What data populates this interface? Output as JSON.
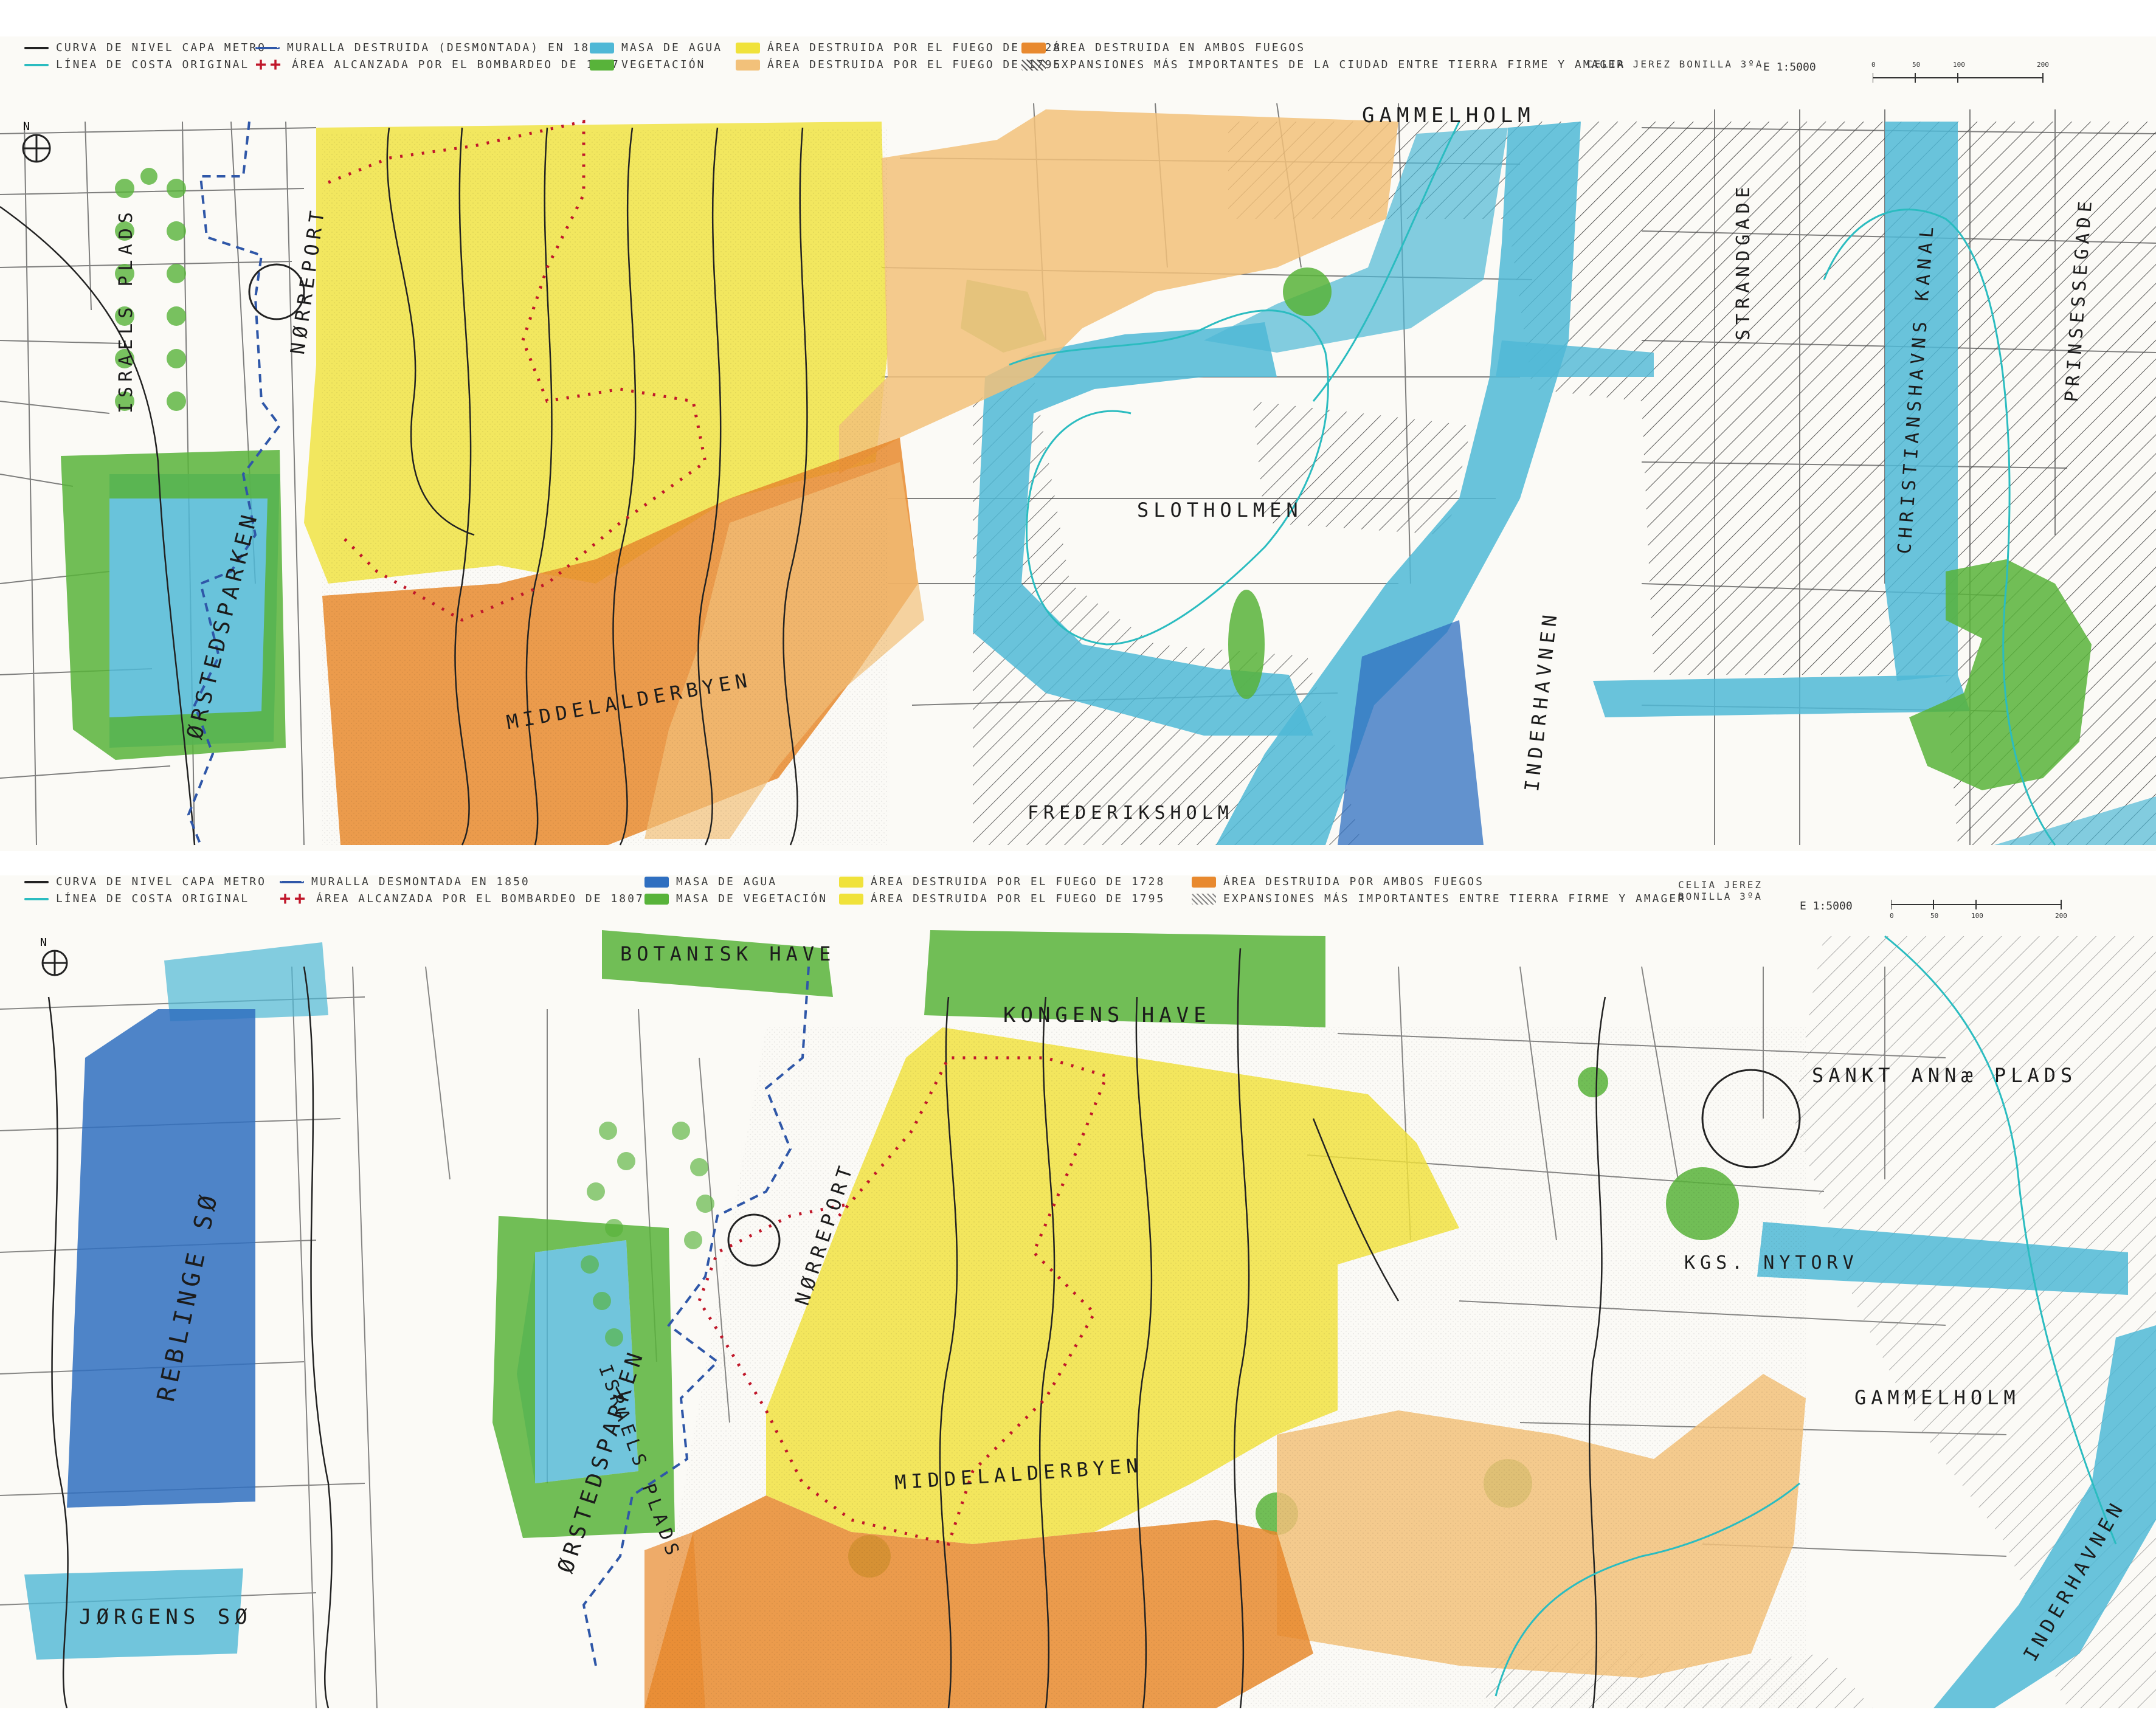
{
  "colors": {
    "water": "#4fb8d6",
    "water_dark": "#2f6fc0",
    "vegetation": "#58b33a",
    "fire_1728": "#f0e23a",
    "fire_1795": "#f2c17a",
    "fire_both": "#e8892e",
    "wall_line": "#2f57a8",
    "bombardment": "#c0172a",
    "coastline": "#2bbcc0",
    "contour": "#222222"
  },
  "top_map": {
    "legend": {
      "contour": "CURVA DE NIVEL CAPA METRO",
      "coastline": "LÍNEA DE COSTA ORIGINAL",
      "wall": "MURALLA DESTRUIDA (DESMONTADA) EN 1850",
      "bombardment": "ÁREA ALCANZADA POR EL BOMBARDEO DE 1807",
      "water": "MASA DE AGUA",
      "vegetation": "VEGETACIÓN",
      "fire_1728": "ÁREA DESTRUIDA POR EL FUEGO DE 1728",
      "fire_1795": "ÁREA DESTRUIDA POR EL FUEGO DE 1795",
      "fire_both": "ÁREA DESTRUIDA EN AMBOS FUEGOS",
      "expansion": "EXPANSIONES MÁS IMPORTANTES DE LA CIUDAD ENTRE TIERRA FIRME Y AMAGER",
      "author": "CELIA JEREZ BONILLA 3ºA",
      "scale": "E 1:5000",
      "scale_ticks": [
        "0",
        "50",
        "100",
        "200"
      ],
      "north": "N"
    },
    "labels": {
      "gammelholm": "GAMMELHOLM",
      "norreport": "NØRREPORT",
      "israels_plads": "ISRAELS PLADS",
      "orstedsparken": "ØRSTEDSPARKEN",
      "middelalderbyen": "MIDDELALDERBYEN",
      "slotholmen": "SLOTHOLMEN",
      "frederiksholm": "FREDERIKSHOLM",
      "inderhavnen": "INDERHAVNEN",
      "strandgade": "STRANDGADE",
      "christianshavns_kanal": "CHRISTIANSHAVNS KANAL",
      "prinsessegade": "PRINSESSEGADE"
    }
  },
  "bottom_map": {
    "legend": {
      "contour": "CURVA DE NIVEL CAPA METRO",
      "coastline": "LÍNEA DE COSTA ORIGINAL",
      "wall": "MURALLA DESMONTADA EN 1850",
      "bombardment": "ÁREA ALCANZADA POR EL BOMBARDEO DE 1807",
      "water": "MASA DE AGUA",
      "vegetation": "MASA DE VEGETACIÓN",
      "fire_1728": "ÁREA DESTRUIDA POR EL FUEGO DE 1728",
      "fire_1795": "ÁREA DESTRUIDA POR EL FUEGO DE 1795",
      "fire_both": "ÁREA DESTRUIDA POR AMBOS FUEGOS",
      "expansion": "EXPANSIONES MÁS IMPORTANTES ENTRE TIERRA FIRME Y AMAGER",
      "author": "CELIA JEREZ BONILLA 3ºA",
      "scale": "E 1:5000",
      "scale_ticks": [
        "0",
        "50",
        "100",
        "200"
      ],
      "north": "N"
    },
    "labels": {
      "botanisk_have": "BOTANISK HAVE",
      "kongens_have": "KONGENS HAVE",
      "sankt_annae_plads": "SANKT ANNæ PLADS",
      "norreport": "NØRREPORT",
      "israels_plads": "ISRAELS PLADS",
      "reblinge_so": "REBLINGE SØ",
      "orstedsparken": "ØRSTEDSPARKEN",
      "middelalderbyen": "MIDDELALDERBYEN",
      "kgs_nytorv": "KGS. NYTORV",
      "gammelholm": "GAMMELHOLM",
      "jorgens_so": "JØRGENS SØ",
      "inderhavnen": "INDERHAVNEN"
    }
  }
}
